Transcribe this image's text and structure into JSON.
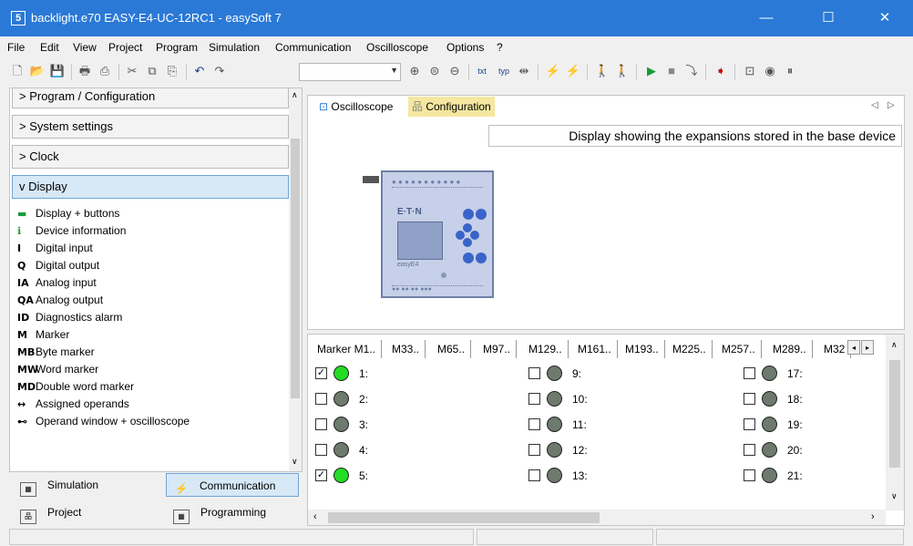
{
  "window": {
    "title": "backlight.e70 EASY-E4-UC-12RC1 - easySoft 7",
    "minimize": "—",
    "maximize": "☐",
    "close": "✕"
  },
  "menu": [
    "File",
    "Edit",
    "View",
    "Project",
    "Program",
    "Simulation",
    "Communication",
    "Oscilloscope",
    "Options",
    "?"
  ],
  "sidebar": {
    "sections": {
      "program": "> Program / Configuration",
      "system": "> System settings",
      "clock": "> Clock",
      "display": "v Display"
    },
    "items": [
      {
        "icon": "display-buttons-icon",
        "glyph": "▬",
        "label": "Display + buttons"
      },
      {
        "icon": "info-icon",
        "glyph": "ℹ",
        "label": "Device information"
      },
      {
        "icon": "digital-input-icon",
        "glyph": "I",
        "label": "Digital input"
      },
      {
        "icon": "digital-output-icon",
        "glyph": "Q",
        "label": "Digital output"
      },
      {
        "icon": "analog-input-icon",
        "glyph": "IA",
        "label": "Analog input"
      },
      {
        "icon": "analog-output-icon",
        "glyph": "QA",
        "label": "Analog output"
      },
      {
        "icon": "diagnostics-alarm-icon",
        "glyph": "ID",
        "label": "Diagnostics alarm"
      },
      {
        "icon": "marker-icon",
        "glyph": "M",
        "label": "Marker"
      },
      {
        "icon": "byte-marker-icon",
        "glyph": "MB",
        "label": "Byte marker"
      },
      {
        "icon": "word-marker-icon",
        "glyph": "MW",
        "label": "Word marker"
      },
      {
        "icon": "double-word-marker-icon",
        "glyph": "MD",
        "label": "Double word marker"
      },
      {
        "icon": "assigned-operands-icon",
        "glyph": "↔",
        "label": "Assigned operands"
      },
      {
        "icon": "oscilloscope-glasses-icon",
        "glyph": "⊷",
        "label": "Operand window + oscilloscope"
      }
    ],
    "bottom_tabs": {
      "simulation": "Simulation",
      "communication": "Communication",
      "project": "Project",
      "programming": "Programming"
    }
  },
  "top_panel": {
    "tabs": {
      "oscilloscope": "Oscilloscope",
      "configuration": "Configuration"
    },
    "hint": "Display showing the expansions stored in the base device",
    "device_brand": "E·T·N",
    "device_model": "easyE4"
  },
  "marker_tabs": [
    "Marker M1..",
    "M33..",
    "M65..",
    "M97..",
    "M129..",
    "M161..",
    "M193..",
    "M225..",
    "M257..",
    "M289..",
    "M32"
  ],
  "markers": [
    {
      "label": "1:",
      "checked": true,
      "on": true
    },
    {
      "label": "2:",
      "checked": false,
      "on": false
    },
    {
      "label": "3:",
      "checked": false,
      "on": false
    },
    {
      "label": "4:",
      "checked": false,
      "on": false
    },
    {
      "label": "5:",
      "checked": true,
      "on": true
    },
    {
      "label": "9:",
      "checked": false,
      "on": false
    },
    {
      "label": "10:",
      "checked": false,
      "on": false
    },
    {
      "label": "11:",
      "checked": false,
      "on": false
    },
    {
      "label": "12:",
      "checked": false,
      "on": false
    },
    {
      "label": "13:",
      "checked": false,
      "on": false
    },
    {
      "label": "17:",
      "checked": false,
      "on": false
    },
    {
      "label": "18:",
      "checked": false,
      "on": false
    },
    {
      "label": "19:",
      "checked": false,
      "on": false
    },
    {
      "label": "20:",
      "checked": false,
      "on": false
    },
    {
      "label": "21:",
      "checked": false,
      "on": false
    }
  ],
  "colors": {
    "titlebar": "#2b79d6",
    "led_on": "#22dd22",
    "led_off": "#6d7a6d",
    "config_tab": "#f6e7a0"
  }
}
